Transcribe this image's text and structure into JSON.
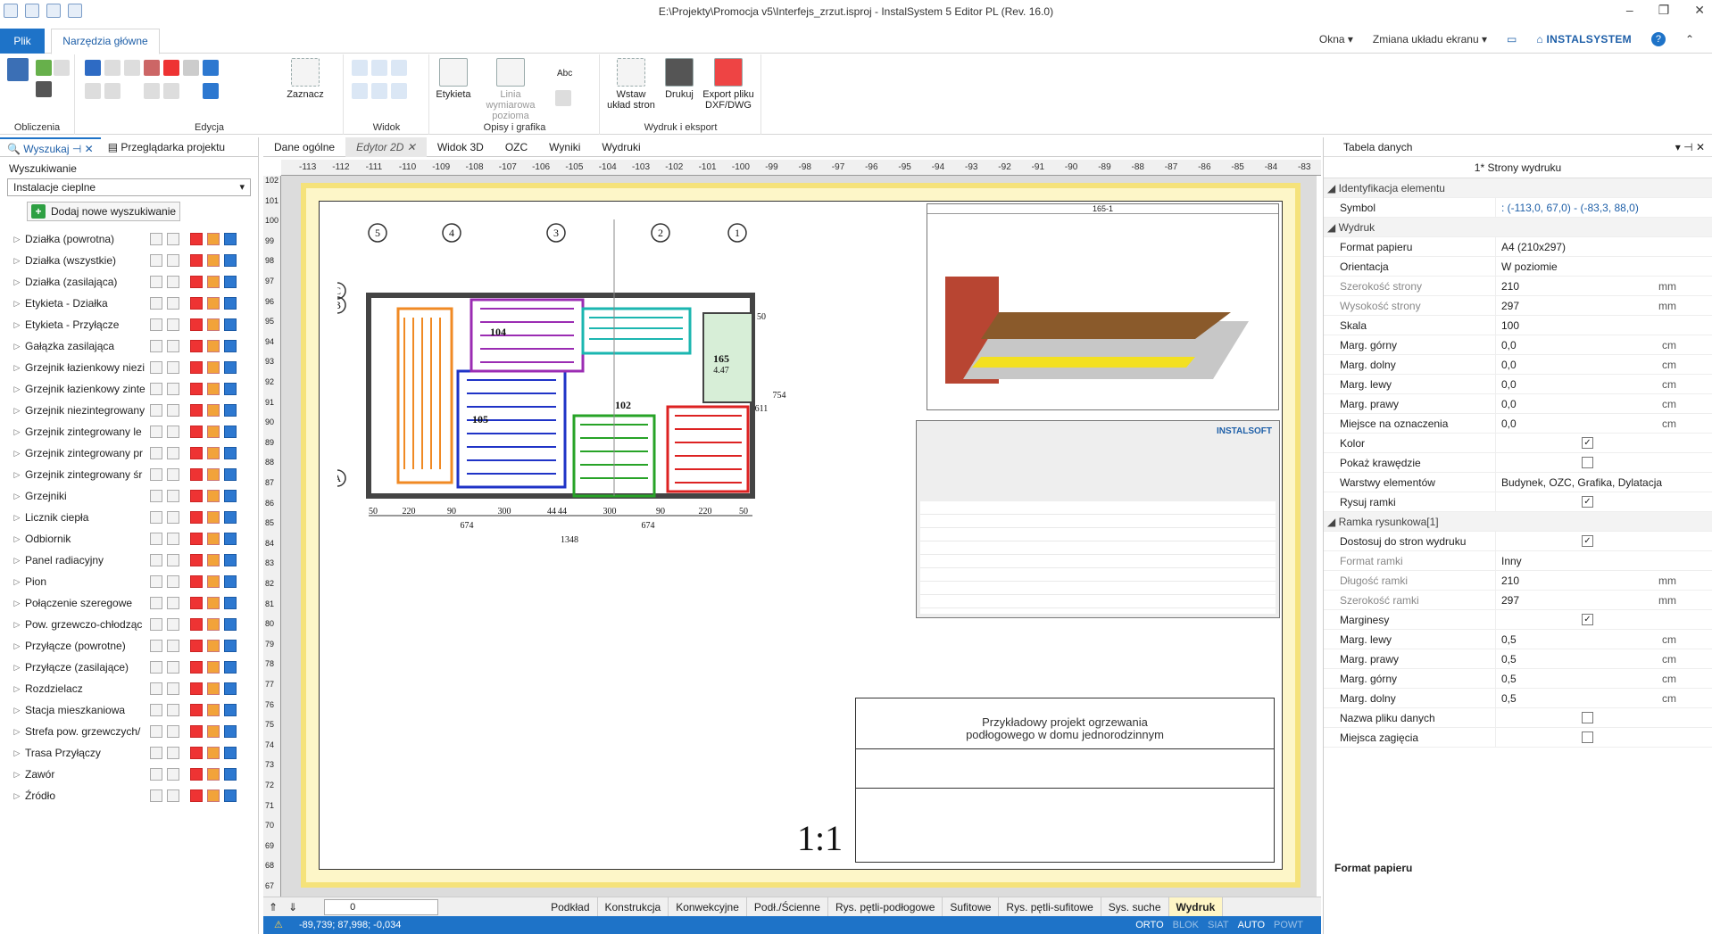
{
  "window": {
    "title": "E:\\Projekty\\Promocja v5\\Interfejs_zrzut.isproj - InstalSystem 5 Editor PL (Rev. 16.0)"
  },
  "ribbon": {
    "file_tab": "Plik",
    "home_tab": "Narzędzia główne",
    "right_menu": [
      "Okna",
      "Zmiana układu ekranu"
    ],
    "brand": "INSTALSYSTEM",
    "groups": [
      "Obliczenia",
      "Edycja",
      "Widok",
      "Opisy i grafika",
      "Wydruk i eksport"
    ],
    "zaznacz": "Zaznacz",
    "etykieta": "Etykieta",
    "linia": "Linia wymiarowa pozioma",
    "wstaw": "Wstaw układ stron",
    "drukuj": "Drukuj",
    "export": "Export pliku DXF/DWG",
    "abc": "Abc"
  },
  "left": {
    "tabs": [
      "Wyszukaj",
      "Przeglądarka projektu"
    ],
    "search_label": "Wyszukiwanie",
    "search_value": "Instalacje cieplne",
    "add_button": "Dodaj nowe wyszukiwanie",
    "items": [
      "Działka (powrotna)",
      "Działka (wszystkie)",
      "Działka (zasilająca)",
      "Etykieta - Działka",
      "Etykieta - Przyłącze",
      "Gałązka zasilająca",
      "Grzejnik łazienkowy niezi",
      "Grzejnik łazienkowy zinte",
      "Grzejnik niezintegrowany",
      "Grzejnik zintegrowany le",
      "Grzejnik zintegrowany pr",
      "Grzejnik zintegrowany śr",
      "Grzejniki",
      "Licznik ciepła",
      "Odbiornik",
      "Panel radiacyjny",
      "Pion",
      "Połączenie szeregowe",
      "Pow. grzewczo-chłodząc",
      "Przyłącze (powrotne)",
      "Przyłącze (zasilające)",
      "Rozdzielacz",
      "Stacja mieszkaniowa",
      "Strefa pow. grzewczych/",
      "Trasa Przyłączy",
      "Zawór",
      "Źródło"
    ]
  },
  "doc": {
    "tabs": [
      "Dane ogólne",
      "Edytor 2D",
      "Widok 3D",
      "OZC",
      "Wyniki",
      "Wydruki"
    ],
    "ruler_top": [
      "-113",
      "-112",
      "-111",
      "-110",
      "-109",
      "-108",
      "-107",
      "-106",
      "-105",
      "-104",
      "-103",
      "-102",
      "-101",
      "-100",
      "-99",
      "-98",
      "-97",
      "-96",
      "-95",
      "-94",
      "-93",
      "-92",
      "-91",
      "-90",
      "-89",
      "-88",
      "-87",
      "-86",
      "-85",
      "-84",
      "-83"
    ],
    "ruler_left": [
      "102",
      "101",
      "100",
      "99",
      "98",
      "97",
      "96",
      "95",
      "94",
      "93",
      "92",
      "91",
      "90",
      "89",
      "88",
      "87",
      "86",
      "85",
      "84",
      "83",
      "82",
      "81",
      "80",
      "79",
      "78",
      "77",
      "76",
      "75",
      "74",
      "73",
      "72",
      "71",
      "70",
      "69",
      "68",
      "67"
    ],
    "title_block_text": [
      "Przykładowy projekt ogrzewania",
      "podłogowego w domu jednorodzinnym"
    ],
    "scale": "1:1",
    "sheet_header": "165-1",
    "table_brand": "INSTALSOFT",
    "plan_labels": {
      "axes": [
        "5",
        "4",
        "3",
        "2",
        "1"
      ],
      "rows": [
        "C",
        "B",
        "A"
      ],
      "rooms": [
        "104",
        "165",
        "105",
        "102"
      ],
      "room_165_area": "4.47",
      "dims": [
        "50",
        "220",
        "90",
        "300",
        "44",
        "44",
        "300",
        "90",
        "220",
        "50"
      ],
      "dim_totals": [
        "674",
        "674",
        "1348"
      ],
      "side_dims": [
        "50",
        "611",
        "754"
      ]
    }
  },
  "layers": [
    "Podkład",
    "Konstrukcja",
    "Konwekcyjne",
    "Podł./Ścienne",
    "Rys. pętli-podłogowe",
    "Sufitowe",
    "Rys. pętli-sufitowe",
    "Sys. suche",
    "Wydruk"
  ],
  "layer_zero": "0",
  "status": {
    "coords": "-89,739; 87,998; -0,034",
    "modes": [
      "ORTO",
      "BLOK",
      "SIAT",
      "AUTO",
      "POWT"
    ]
  },
  "right": {
    "title": "Tabela danych",
    "subtitle": "1* Strony wydruku",
    "sections": {
      "ident": "Identyfikacja elementu",
      "wydruk": "Wydruk",
      "ramka": "Ramka rysunkowa[1]"
    },
    "symbol_label": "Symbol",
    "symbol_value": ": (-113,0, 67,0) - (-83,3, 88,0)",
    "rows": [
      {
        "n": "Format papieru",
        "v": "A4 (210x297)",
        "u": "",
        "dim": false
      },
      {
        "n": "Orientacja",
        "v": "W poziomie",
        "u": "",
        "dim": false
      },
      {
        "n": "Szerokość strony",
        "v": "210",
        "u": "mm",
        "dim": true
      },
      {
        "n": "Wysokość strony",
        "v": "297",
        "u": "mm",
        "dim": true
      },
      {
        "n": "Skala",
        "v": "100",
        "u": "",
        "dim": false
      },
      {
        "n": "Marg. górny",
        "v": "0,0",
        "u": "cm",
        "dim": false
      },
      {
        "n": "Marg. dolny",
        "v": "0,0",
        "u": "cm",
        "dim": false
      },
      {
        "n": "Marg. lewy",
        "v": "0,0",
        "u": "cm",
        "dim": false
      },
      {
        "n": "Marg. prawy",
        "v": "0,0",
        "u": "cm",
        "dim": false
      },
      {
        "n": "Miejsce na oznaczenia",
        "v": "0,0",
        "u": "cm",
        "dim": false
      },
      {
        "n": "Kolor",
        "v": "",
        "u": "",
        "dim": false,
        "checked": true
      },
      {
        "n": "Pokaż krawędzie",
        "v": "",
        "u": "",
        "dim": false,
        "checked": false
      },
      {
        "n": "Warstwy elementów",
        "v": "Budynek, OZC, Grafika, Dylatacja",
        "u": "",
        "dim": false
      },
      {
        "n": "Rysuj ramki",
        "v": "",
        "u": "",
        "dim": false,
        "checked": true
      }
    ],
    "ramka_rows": [
      {
        "n": "Dostosuj do stron wydruku",
        "v": "",
        "u": "",
        "dim": false,
        "checked": true
      },
      {
        "n": "Format ramki",
        "v": "Inny",
        "u": "",
        "dim": true
      },
      {
        "n": "Długość ramki",
        "v": "210",
        "u": "mm",
        "dim": true
      },
      {
        "n": "Szerokość ramki",
        "v": "297",
        "u": "mm",
        "dim": true
      },
      {
        "n": "Marginesy",
        "v": "",
        "u": "",
        "dim": false,
        "checked": true
      },
      {
        "n": "Marg. lewy",
        "v": "0,5",
        "u": "cm",
        "dim": false
      },
      {
        "n": "Marg. prawy",
        "v": "0,5",
        "u": "cm",
        "dim": false
      },
      {
        "n": "Marg. górny",
        "v": "0,5",
        "u": "cm",
        "dim": false
      },
      {
        "n": "Marg. dolny",
        "v": "0,5",
        "u": "cm",
        "dim": false
      },
      {
        "n": "Nazwa pliku danych",
        "v": "",
        "u": "",
        "dim": false,
        "checked": false
      },
      {
        "n": "Miejsca zagięcia",
        "v": "",
        "u": "",
        "dim": false,
        "checked": false
      }
    ],
    "footer_label": "Format papieru"
  },
  "colors": {
    "accent": "#1e73c8",
    "paper_border": "#f5e27a",
    "status": "#1e73c8"
  }
}
